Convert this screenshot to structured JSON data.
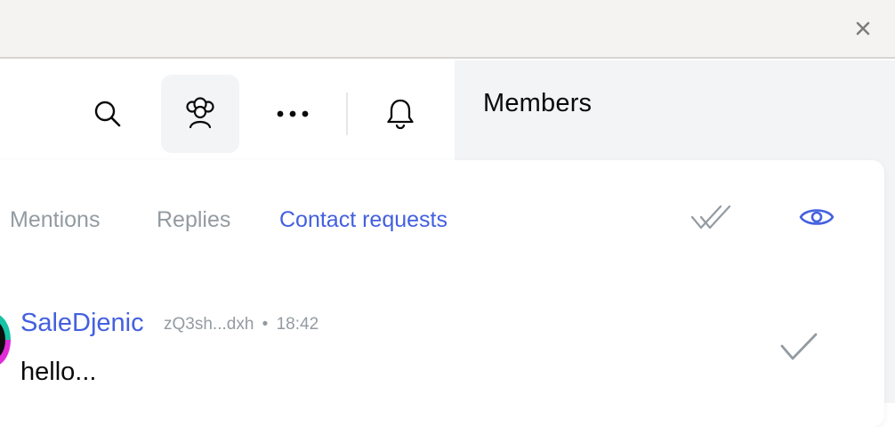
{
  "window": {
    "close_icon": "close-icon"
  },
  "toolbar": {
    "buttons": [
      {
        "name": "search",
        "icon": "search-icon"
      },
      {
        "name": "members",
        "icon": "members-icon",
        "active": true
      },
      {
        "name": "more",
        "icon": "more-icon"
      },
      {
        "name": "notifications",
        "icon": "bell-icon"
      }
    ]
  },
  "members_panel": {
    "title": "Members"
  },
  "activity_center": {
    "tabs": [
      {
        "label": "Mentions",
        "active": false
      },
      {
        "label": "Replies",
        "active": false
      },
      {
        "label": "Contact requests",
        "active": true
      }
    ],
    "actions": [
      {
        "name": "mark-all-read",
        "icon": "double-check-icon"
      },
      {
        "name": "show-read",
        "icon": "eye-icon"
      }
    ],
    "notification": {
      "sender": "SaleDjenic",
      "address": "zQ3sh...dxh",
      "separator": "•",
      "time": "18:42",
      "text": "hello...",
      "action_icon": "check-icon"
    }
  },
  "colors": {
    "accent": "#4360df",
    "muted": "#939ba1",
    "titlebar_bg": "#f4f3f2",
    "panel_bg": "#f3f4f6"
  }
}
